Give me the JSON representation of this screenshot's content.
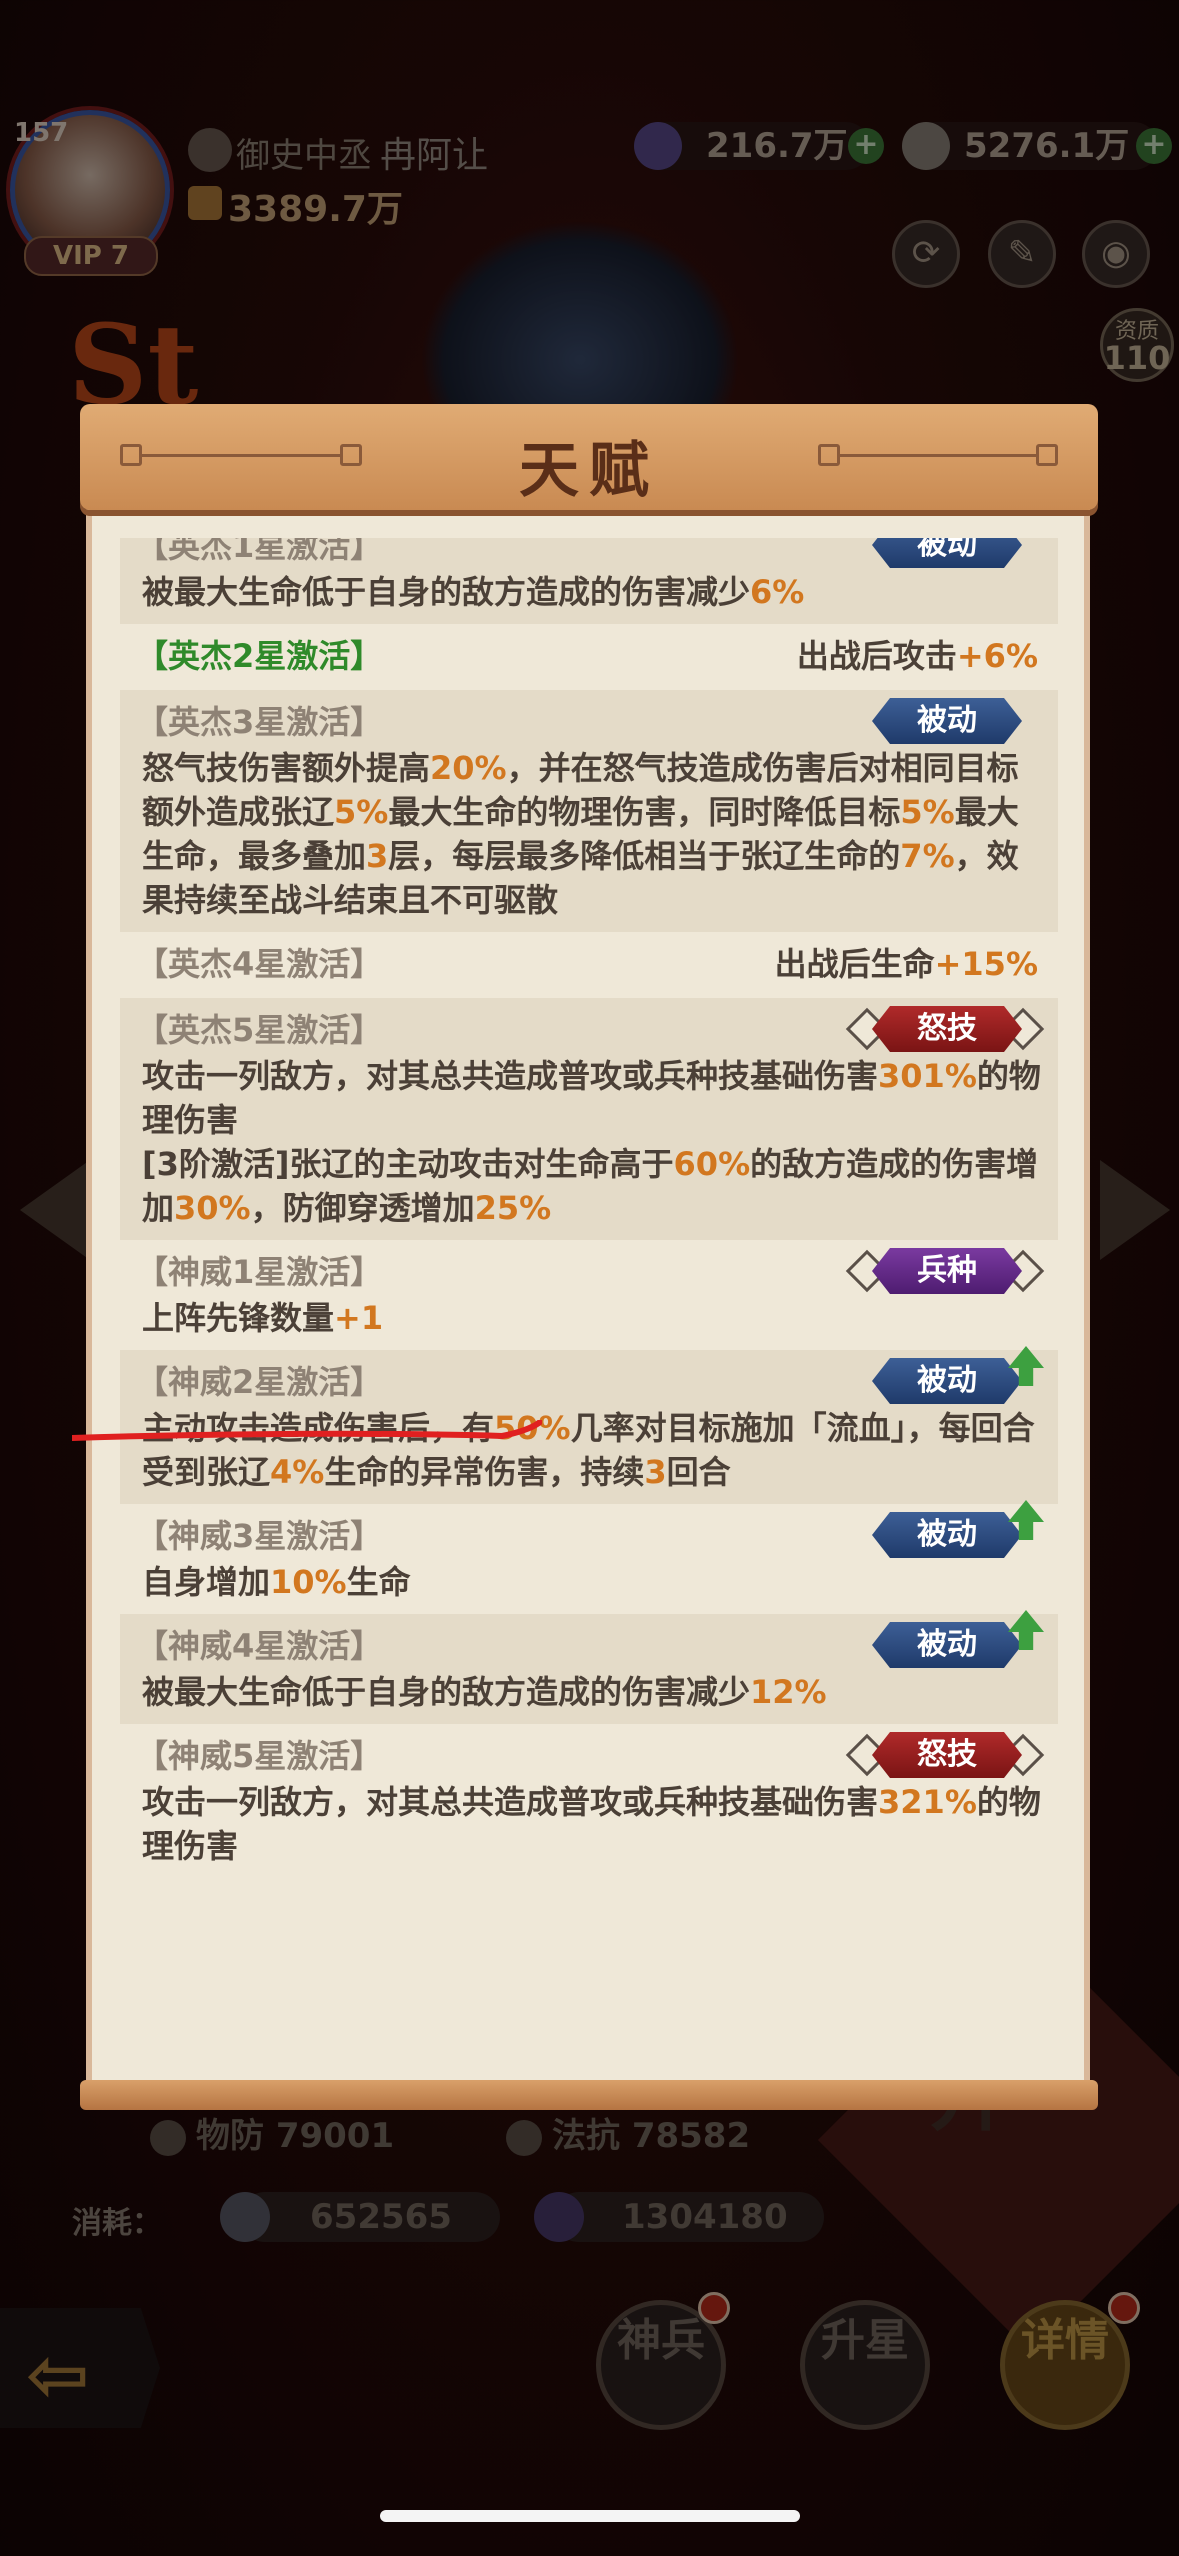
{
  "player": {
    "level": "157",
    "vip": "VIP 7",
    "rank_title": "御史中丞",
    "name": "冉阿让",
    "power": "3389.7万"
  },
  "currencies": [
    {
      "value": "216.7万",
      "icon": "gem-icon"
    },
    {
      "value": "5276.1万",
      "icon": "coin-icon"
    }
  ],
  "top_buttons": [
    "refresh-icon",
    "skin-icon",
    "eye-icon"
  ],
  "aptitude": {
    "label": "资质",
    "value": "110"
  },
  "background": {
    "st": "St"
  },
  "modal": {
    "title": "天赋",
    "rows": [
      {
        "title": "【英杰1星激活】",
        "tag": "被动",
        "tag_type": "passive",
        "desc": [
          [
            "被最大生命低于自身的敌方造成的伤害减少",
            "n"
          ],
          [
            "6%",
            "h"
          ]
        ]
      },
      {
        "title": "【英杰2星激活】",
        "green": true,
        "bonus": [
          [
            "出战后攻击",
            "n"
          ],
          [
            "+6%",
            "h"
          ]
        ]
      },
      {
        "title": "【英杰3星激活】",
        "tag": "被动",
        "tag_type": "passive",
        "desc": [
          [
            "怒气技伤害额外提高",
            "n"
          ],
          [
            "20%",
            "h"
          ],
          [
            "，并在怒气技造成伤害后对相同目标额外造成张辽",
            "n"
          ],
          [
            "5%",
            "h"
          ],
          [
            "最大生命的物理伤害，同时降低目标",
            "n"
          ],
          [
            "5%",
            "h"
          ],
          [
            "最大生命，最多叠加",
            "n"
          ],
          [
            "3",
            "h"
          ],
          [
            "层，每层最多降低相当于张辽生命的",
            "n"
          ],
          [
            "7%",
            "h"
          ],
          [
            "，效果持续至战斗结束且不可驱散",
            "n"
          ]
        ]
      },
      {
        "title": "【英杰4星激活】",
        "bonus": [
          [
            "出战后生命",
            "n"
          ],
          [
            "+15%",
            "h"
          ]
        ]
      },
      {
        "title": "【英杰5星激活】",
        "tag": "怒技",
        "tag_type": "rage",
        "desc": [
          [
            "攻击一列敌方，对其总共造成普攻或兵种技基础伤害",
            "n"
          ],
          [
            "301%",
            "h"
          ],
          [
            "的物理伤害\n[3阶激活]张辽的主动攻击对生命高于",
            "n"
          ],
          [
            "60%",
            "h"
          ],
          [
            "的敌方造成的伤害增加",
            "n"
          ],
          [
            "30%",
            "h"
          ],
          [
            "，防御穿透增加",
            "n"
          ],
          [
            "25%",
            "h"
          ]
        ]
      },
      {
        "title": "【神威1星激活】",
        "tag": "兵种",
        "tag_type": "troop",
        "desc": [
          [
            "上阵先锋数量",
            "n"
          ],
          [
            "+1",
            "h"
          ]
        ]
      },
      {
        "title": "【神威2星激活】",
        "tag": "被动",
        "tag_type": "passive",
        "arrow": true,
        "desc": [
          [
            "主动攻击造成伤害后，有",
            "n"
          ],
          [
            "50%",
            "h"
          ],
          [
            "几率对目标施加「流血」，每回合受到张辽",
            "n"
          ],
          [
            "4%",
            "h"
          ],
          [
            "生命的异常伤害，持续",
            "n"
          ],
          [
            "3",
            "h"
          ],
          [
            "回合",
            "n"
          ]
        ]
      },
      {
        "title": "【神威3星激活】",
        "tag": "被动",
        "tag_type": "passive",
        "arrow": true,
        "desc": [
          [
            "自身增加",
            "n"
          ],
          [
            "10%",
            "h"
          ],
          [
            "生命",
            "n"
          ]
        ]
      },
      {
        "title": "【神威4星激活】",
        "tag": "被动",
        "tag_type": "passive",
        "arrow": true,
        "desc": [
          [
            "被最大生命低于自身的敌方造成的伤害减少",
            "n"
          ],
          [
            "12%",
            "h"
          ]
        ]
      },
      {
        "title": "【神威5星激活】",
        "tag": "怒技",
        "tag_type": "rage",
        "desc": [
          [
            "攻击一列敌方，对其总共造成普攻或兵种技基础伤害",
            "n"
          ],
          [
            "321%",
            "h"
          ],
          [
            "的物理伤害",
            "n"
          ]
        ]
      }
    ]
  },
  "stats": {
    "phys_def": "物防 79001",
    "mag_res": "法抗 78582"
  },
  "cost": {
    "label": "消耗：",
    "coin": "652565",
    "gem": "1304180"
  },
  "bottom_buttons": [
    {
      "label": "神兵",
      "key": "divine-weapon"
    },
    {
      "label": "升星",
      "key": "star-up"
    },
    {
      "label": "详情",
      "key": "details"
    }
  ],
  "upgrade_label": "升",
  "colors": {
    "highlight": "#d2771f",
    "green_title": "#2f8a2a",
    "passive": "#2b4a80",
    "rage": "#9a1e1e",
    "troop": "#5e2a84",
    "annotation": "#e02020"
  }
}
